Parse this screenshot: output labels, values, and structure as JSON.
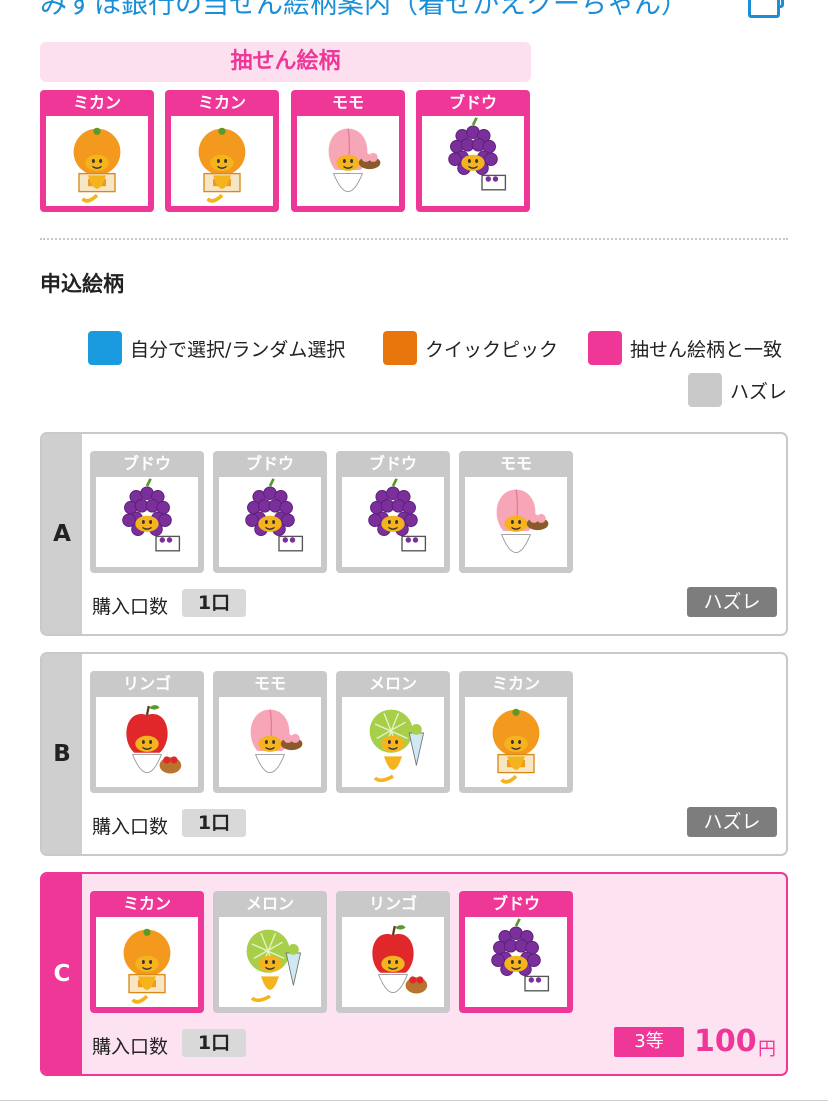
{
  "header": {
    "title": "みずほ銀行の当せん絵柄案内（着せかえクーちゃん）"
  },
  "draw": {
    "title": "抽せん絵柄",
    "items": [
      {
        "label": "ミカン",
        "icon": "mikan-character-icon"
      },
      {
        "label": "ミカン",
        "icon": "mikan-character-icon"
      },
      {
        "label": "モモ",
        "icon": "momo-character-icon"
      },
      {
        "label": "ブドウ",
        "icon": "budou-character-icon"
      }
    ]
  },
  "entries_section": {
    "title": "申込絵柄",
    "legend": [
      {
        "label": "自分で選択/ランダム選択",
        "color": "#1a9be0"
      },
      {
        "label": "クイックピック",
        "color": "#e8760c"
      },
      {
        "label": "抽せん絵柄と一致",
        "color": "#ee3797"
      },
      {
        "label": "ハズレ",
        "color": "#c9c9c9"
      }
    ]
  },
  "entries": [
    {
      "letter": "A",
      "items": [
        {
          "label": "ブドウ",
          "match": false
        },
        {
          "label": "ブドウ",
          "match": false
        },
        {
          "label": "ブドウ",
          "match": false
        },
        {
          "label": "モモ",
          "match": false
        }
      ],
      "qty_label": "購入口数",
      "qty": "1口",
      "result": "ハズレ"
    },
    {
      "letter": "B",
      "items": [
        {
          "label": "リンゴ",
          "match": false
        },
        {
          "label": "モモ",
          "match": false
        },
        {
          "label": "メロン",
          "match": false
        },
        {
          "label": "ミカン",
          "match": false
        }
      ],
      "qty_label": "購入口数",
      "qty": "1口",
      "result": "ハズレ"
    },
    {
      "letter": "C",
      "items": [
        {
          "label": "ミカン",
          "match": true
        },
        {
          "label": "メロン",
          "match": false
        },
        {
          "label": "リンゴ",
          "match": false
        },
        {
          "label": "ブドウ",
          "match": true
        }
      ],
      "qty_label": "購入口数",
      "qty": "1口",
      "prize_rank": "3等",
      "prize_amount": "100",
      "prize_unit": "円"
    }
  ],
  "colors": {
    "pink": "#ee3797",
    "link_blue": "#1a8fd8",
    "gray": "#c9c9c9",
    "lose": "#7d7d7d"
  }
}
